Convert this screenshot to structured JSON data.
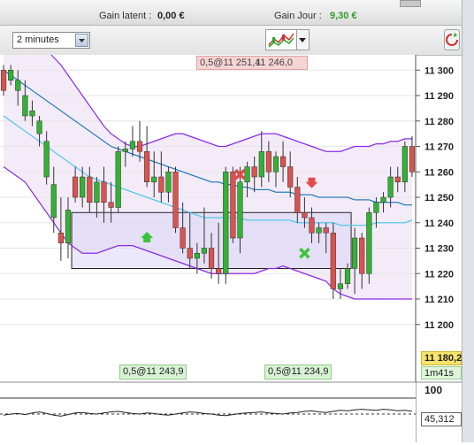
{
  "header": {
    "unrealized_label": "Gain latent :",
    "unrealized_value": "0,00 €",
    "daily_label": "Gain Jour :",
    "daily_value": "9,30 €"
  },
  "toolbar": {
    "timeframe": "2 minutes"
  },
  "orders": {
    "top": "0,5@11 251,4",
    "top_overlap": "11 246,0",
    "bottom_left": "0,5@11 243,9",
    "bottom_right": "0,5@11 234,9"
  },
  "price_axis": {
    "ticks": [
      "11 300",
      "11 290",
      "11 280",
      "11 270",
      "11 260",
      "11 250",
      "11 240",
      "11 230",
      "11 220",
      "11 210",
      "11 200"
    ],
    "current_price": "11 180,2",
    "countdown": "1m41s"
  },
  "indicator": {
    "top_label": "100",
    "value": "45,312"
  },
  "colors": {
    "up": "#33b233",
    "down": "#d9534f",
    "band": "#8a2be2",
    "ma": "#55c8e8",
    "ma_slow": "#2a7fb8",
    "positive": "#2e9d2e"
  },
  "chart_data": {
    "type": "candlestick",
    "ylim": [
      11178,
      11306
    ],
    "candles": [
      [
        11300,
        11302,
        11290,
        11292
      ],
      [
        11296,
        11302,
        11294,
        11300
      ],
      [
        11292,
        11300,
        11286,
        11296
      ],
      [
        11282,
        11296,
        11280,
        11290
      ],
      [
        11282,
        11288,
        11278,
        11284
      ],
      [
        11275,
        11282,
        11270,
        11280
      ],
      [
        11258,
        11276,
        11255,
        11272
      ],
      [
        11242,
        11262,
        11236,
        11255
      ],
      [
        11236,
        11250,
        11225,
        11232
      ],
      [
        11232,
        11250,
        11226,
        11245
      ],
      [
        11258,
        11262,
        11248,
        11250
      ],
      [
        11250,
        11262,
        11246,
        11258
      ],
      [
        11258,
        11262,
        11244,
        11248
      ],
      [
        11248,
        11258,
        11242,
        11256
      ],
      [
        11256,
        11262,
        11240,
        11248
      ],
      [
        11248,
        11256,
        11240,
        11246
      ],
      [
        11246,
        11270,
        11244,
        11268
      ],
      [
        11268,
        11272,
        11262,
        11269
      ],
      [
        11269,
        11278,
        11266,
        11272
      ],
      [
        11272,
        11280,
        11264,
        11268
      ],
      [
        11268,
        11278,
        11254,
        11256
      ],
      [
        11256,
        11268,
        11250,
        11258
      ],
      [
        11258,
        11268,
        11248,
        11252
      ],
      [
        11252,
        11262,
        11248,
        11260
      ],
      [
        11260,
        11262,
        11236,
        11238
      ],
      [
        11238,
        11248,
        11228,
        11230
      ],
      [
        11230,
        11244,
        11222,
        11226
      ],
      [
        11226,
        11232,
        11220,
        11228
      ],
      [
        11228,
        11246,
        11224,
        11230
      ],
      [
        11230,
        11236,
        11218,
        11222
      ],
      [
        11222,
        11240,
        11216,
        11220
      ],
      [
        11220,
        11262,
        11216,
        11260
      ],
      [
        11260,
        11262,
        11232,
        11234
      ],
      [
        11234,
        11262,
        11228,
        11256
      ],
      [
        11256,
        11264,
        11250,
        11262
      ],
      [
        11262,
        11266,
        11252,
        11258
      ],
      [
        11258,
        11276,
        11254,
        11268
      ],
      [
        11268,
        11272,
        11256,
        11260
      ],
      [
        11260,
        11268,
        11254,
        11266
      ],
      [
        11266,
        11272,
        11256,
        11262
      ],
      [
        11262,
        11268,
        11250,
        11254
      ],
      [
        11254,
        11258,
        11240,
        11244
      ],
      [
        11244,
        11250,
        11238,
        11242
      ],
      [
        11242,
        11246,
        11232,
        11236
      ],
      [
        11236,
        11240,
        11232,
        11238
      ],
      [
        11238,
        11240,
        11228,
        11236
      ],
      [
        11236,
        11240,
        11210,
        11214
      ],
      [
        11214,
        11222,
        11210,
        11216
      ],
      [
        11216,
        11224,
        11214,
        11222
      ],
      [
        11222,
        11238,
        11212,
        11234
      ],
      [
        11234,
        11236,
        11214,
        11220
      ],
      [
        11220,
        11246,
        11216,
        11244
      ],
      [
        11244,
        11250,
        11238,
        11248
      ],
      [
        11248,
        11252,
        11244,
        11250
      ],
      [
        11250,
        11262,
        11246,
        11258
      ],
      [
        11258,
        11262,
        11252,
        11256
      ],
      [
        11256,
        11272,
        11252,
        11270
      ],
      [
        11270,
        11274,
        11258,
        11260
      ]
    ],
    "band_upper": [
      11315,
      11314,
      11313,
      11312,
      11311,
      11310,
      11308,
      11305,
      11302,
      11298,
      11294,
      11290,
      11286,
      11282,
      11278,
      11275,
      11273,
      11271,
      11270,
      11270,
      11271,
      11272,
      11273,
      11274,
      11275,
      11275,
      11274,
      11273,
      11272,
      11271,
      11270,
      11270,
      11271,
      11272,
      11273,
      11274,
      11275,
      11275,
      11275,
      11274,
      11273,
      11272,
      11271,
      11270,
      11269,
      11268,
      11268,
      11268,
      11269,
      11270,
      11270,
      11270,
      11271,
      11271,
      11272,
      11272,
      11273,
      11273
    ],
    "band_lower": [
      11262,
      11260,
      11258,
      11256,
      11252,
      11248,
      11244,
      11240,
      11236,
      11232,
      11230,
      11228,
      11228,
      11228,
      11229,
      11230,
      11231,
      11231,
      11231,
      11230,
      11229,
      11228,
      11227,
      11226,
      11225,
      11224,
      11223,
      11222,
      11221,
      11220,
      11220,
      11220,
      11220,
      11220,
      11220,
      11220,
      11221,
      11222,
      11222,
      11223,
      11222,
      11221,
      11220,
      11219,
      11218,
      11217,
      11214,
      11212,
      11211,
      11210,
      11210,
      11210,
      11210,
      11210,
      11210,
      11210,
      11210,
      11210
    ],
    "ma_fast": [
      11282,
      11280,
      11278,
      11276,
      11274,
      11272,
      11270,
      11268,
      11266,
      11264,
      11262,
      11260,
      11258,
      11257,
      11256,
      11255,
      11254,
      11253,
      11252,
      11251,
      11250,
      11249,
      11248,
      11247,
      11246,
      11245,
      11244,
      11243,
      11242,
      11242,
      11242,
      11242,
      11242,
      11242,
      11241,
      11241,
      11241,
      11241,
      11241,
      11241,
      11241,
      11240,
      11240,
      11240,
      11240,
      11240,
      11240,
      11239,
      11239,
      11239,
      11239,
      11239,
      11240,
      11240,
      11240,
      11240,
      11240,
      11241
    ],
    "ma_slow": [
      11300,
      11298,
      11296,
      11294,
      11292,
      11290,
      11288,
      11286,
      11284,
      11282,
      11280,
      11278,
      11276,
      11274,
      11272,
      11270,
      11269,
      11268,
      11267,
      11266,
      11265,
      11264,
      11263,
      11262,
      11261,
      11260,
      11259,
      11258,
      11257,
      11256,
      11256,
      11255,
      11255,
      11254,
      11254,
      11253,
      11253,
      11253,
      11252,
      11252,
      11252,
      11251,
      11251,
      11251,
      11250,
      11250,
      11250,
      11250,
      11250,
      11249,
      11249,
      11249,
      11248,
      11248,
      11248,
      11248,
      11247,
      11247
    ],
    "range_box": {
      "from_candle": 10,
      "to_candle": 48,
      "top": 11244,
      "bottom": 11222
    },
    "entry_markers": [
      {
        "type": "buy",
        "candle": 20,
        "price": 11234
      },
      {
        "type": "sell",
        "candle": 43,
        "price": 11256
      }
    ],
    "exit_markers": [
      {
        "type": "close-sell",
        "candle": 33,
        "price": 11259
      },
      {
        "type": "close-buy",
        "candle": 42,
        "price": 11228
      }
    ],
    "indicator_series": [
      38,
      40,
      41,
      39,
      42,
      44,
      41,
      38,
      36,
      39,
      42,
      43,
      41,
      40,
      42,
      44,
      45,
      43,
      41,
      40,
      42,
      41,
      39,
      38,
      40,
      42,
      44,
      43,
      41,
      40,
      38,
      37,
      39,
      41,
      42,
      43,
      44,
      42,
      41,
      40,
      42,
      43,
      45,
      46,
      44,
      43,
      45,
      47,
      46,
      48,
      49,
      48,
      47,
      49,
      48,
      46,
      47,
      45
    ]
  }
}
